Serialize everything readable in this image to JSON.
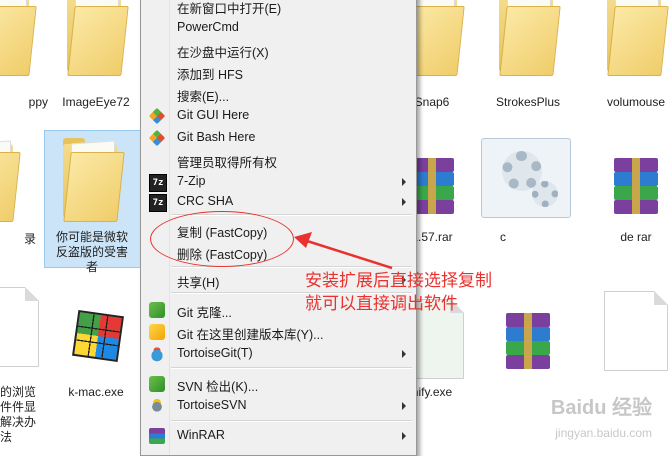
{
  "files": {
    "top_row": [
      {
        "name": "ppy"
      },
      {
        "name": "ImageEye72"
      },
      {
        "name": "Snap6"
      },
      {
        "name": "StrokesPlus"
      },
      {
        "name": "volumouse"
      }
    ],
    "middle_row": [
      {
        "name": "录"
      },
      {
        "name": "你可能是微软反盗版的受害者"
      },
      {
        "name": "1.57.rar"
      },
      {
        "name": "c"
      },
      {
        "name": "de   rar"
      }
    ],
    "bottom_row": [
      {
        "name": "的浏览件件显解决办法"
      },
      {
        "name": "k-mac.exe"
      },
      {
        "name": "nify.exe"
      },
      {
        "name": ""
      },
      {
        "name": ""
      }
    ]
  },
  "context_menu": {
    "items": [
      {
        "label": "在新窗口中打开(E)",
        "icon": "",
        "submenu": false
      },
      {
        "label": "PowerCmd",
        "icon": "",
        "submenu": false
      },
      {
        "label": "在沙盘中运行(X)",
        "icon": "",
        "submenu": false
      },
      {
        "label": "添加到 HFS",
        "icon": "",
        "submenu": false
      },
      {
        "label": "搜索(E)...",
        "icon": "",
        "submenu": false
      },
      {
        "label": "Git GUI Here",
        "icon": "git-icon",
        "submenu": false
      },
      {
        "label": "Git Bash Here",
        "icon": "git-icon",
        "submenu": false
      },
      {
        "label": "管理员取得所有权",
        "icon": "",
        "submenu": false
      },
      {
        "label": "7-Zip",
        "icon": "7zip-icon",
        "submenu": true
      },
      {
        "label": "CRC SHA",
        "icon": "7zip-icon",
        "submenu": true
      },
      {
        "label": "复制 (FastCopy)",
        "icon": "",
        "submenu": false
      },
      {
        "label": "删除 (FastCopy)",
        "icon": "",
        "submenu": false
      },
      {
        "label": "共享(H)",
        "icon": "",
        "submenu": true
      },
      {
        "label": "Git 克隆...",
        "icon": "git-clone-icon",
        "submenu": false
      },
      {
        "label": "Git 在这里创建版本库(Y)...",
        "icon": "git-init-icon",
        "submenu": false
      },
      {
        "label": "TortoiseGit(T)",
        "icon": "tortoisegit-icon",
        "submenu": true
      },
      {
        "label": "SVN 检出(K)...",
        "icon": "svn-checkout-icon",
        "submenu": false
      },
      {
        "label": "TortoiseSVN",
        "icon": "tortoisesvn-icon",
        "submenu": true
      },
      {
        "label": "WinRAR",
        "icon": "winrar-icon",
        "submenu": true
      }
    ],
    "seven_zip_glyph": "7z"
  },
  "annotation": {
    "line1": "安装扩展后直接选择复制",
    "line2": "就可以直接调出软件",
    "color": "#e8322f"
  },
  "watermark": {
    "brand": "Baidu 经验",
    "url": "jingyan.baidu.com"
  }
}
